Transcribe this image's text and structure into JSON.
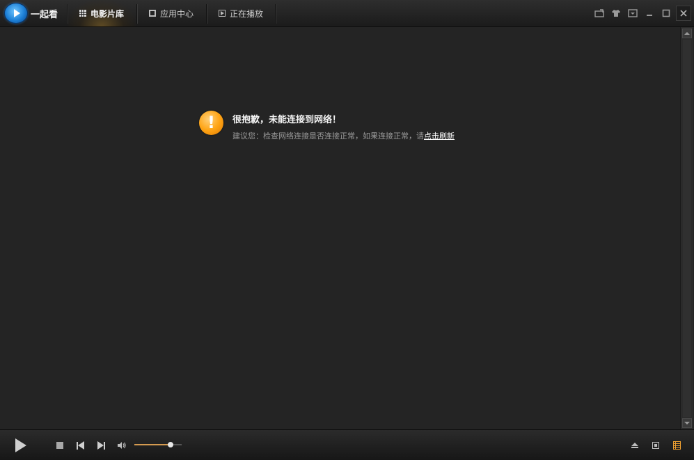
{
  "app": {
    "name": "一起看"
  },
  "nav": {
    "tabs": [
      {
        "label": "电影片库",
        "icon": "film-grid-icon",
        "active": true
      },
      {
        "label": "应用中心",
        "icon": "app-icon",
        "active": false
      },
      {
        "label": "正在播放",
        "icon": "now-playing-icon",
        "active": false
      }
    ]
  },
  "window_controls": [
    "mini-mode-icon",
    "skin-icon",
    "menu-icon",
    "minimize-icon",
    "maximize-icon",
    "close-icon"
  ],
  "error": {
    "title": "很抱歉，未能连接到网络！",
    "message_prefix": "建议您：检查网络连接是否连接正常，如果连接正常，请",
    "refresh_link": "点击刷新"
  },
  "player": {
    "volume_level": 0.77,
    "accent_color": "#d49a50"
  },
  "colors": {
    "background": "#242424",
    "warning": "#ffa516"
  }
}
